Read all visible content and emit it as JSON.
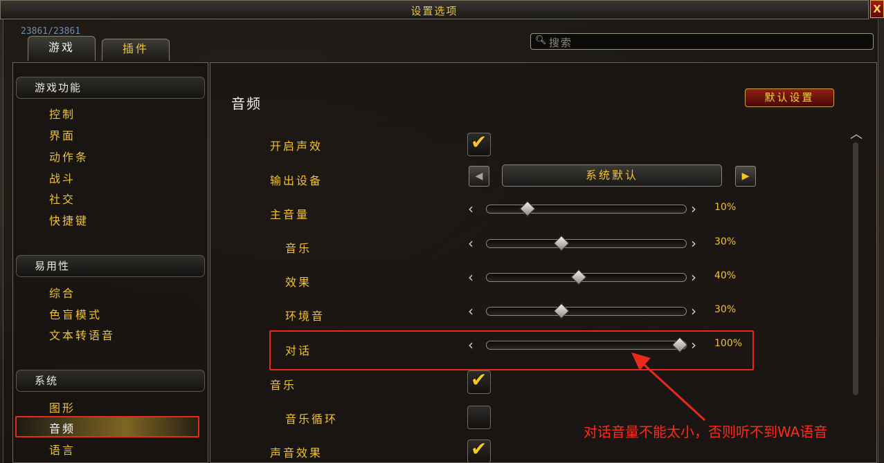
{
  "window": {
    "title": "设置选项",
    "close_label": "X",
    "health_readout": "23861/23861"
  },
  "tabs": [
    {
      "label": "游戏",
      "active": true
    },
    {
      "label": "插件",
      "active": false
    }
  ],
  "search": {
    "placeholder": "搜索",
    "icon": "search-icon"
  },
  "sidebar": {
    "categories": [
      {
        "header": "游戏功能",
        "items": [
          "控制",
          "界面",
          "动作条",
          "战斗",
          "社交",
          "快捷键"
        ]
      },
      {
        "header": "易用性",
        "items": [
          "综合",
          "色盲模式",
          "文本转语音"
        ]
      },
      {
        "header": "系统",
        "items": [
          "图形",
          "音频",
          "语言"
        ]
      }
    ],
    "selected": "音频"
  },
  "panel": {
    "title": "音频",
    "default_button": "默认设置",
    "options": {
      "enable_sound": {
        "label": "开启声效",
        "checked": true
      },
      "output_device": {
        "label": "输出设备",
        "value": "系统默认"
      },
      "master_volume": {
        "label": "主音量",
        "value": "10%",
        "level": 0.1
      },
      "music_volume": {
        "label": "音乐",
        "value": "30%",
        "level": 0.3
      },
      "effects_volume": {
        "label": "效果",
        "value": "40%",
        "level": 0.4
      },
      "ambience_volume": {
        "label": "环境音",
        "value": "30%",
        "level": 0.3
      },
      "dialog_volume": {
        "label": "对话",
        "value": "100%",
        "level": 1.0
      },
      "music_toggle": {
        "label": "音乐",
        "checked": true
      },
      "music_loop": {
        "label": "音乐循环",
        "checked": false
      },
      "sound_effects": {
        "label": "声音效果",
        "checked": true
      }
    }
  },
  "annotation": {
    "text": "对话音量不能太小，否则听不到WA语音",
    "color": "#ff2a1a"
  },
  "colors": {
    "label_gold": "#f1c232",
    "highlight_red": "#e8291c"
  }
}
